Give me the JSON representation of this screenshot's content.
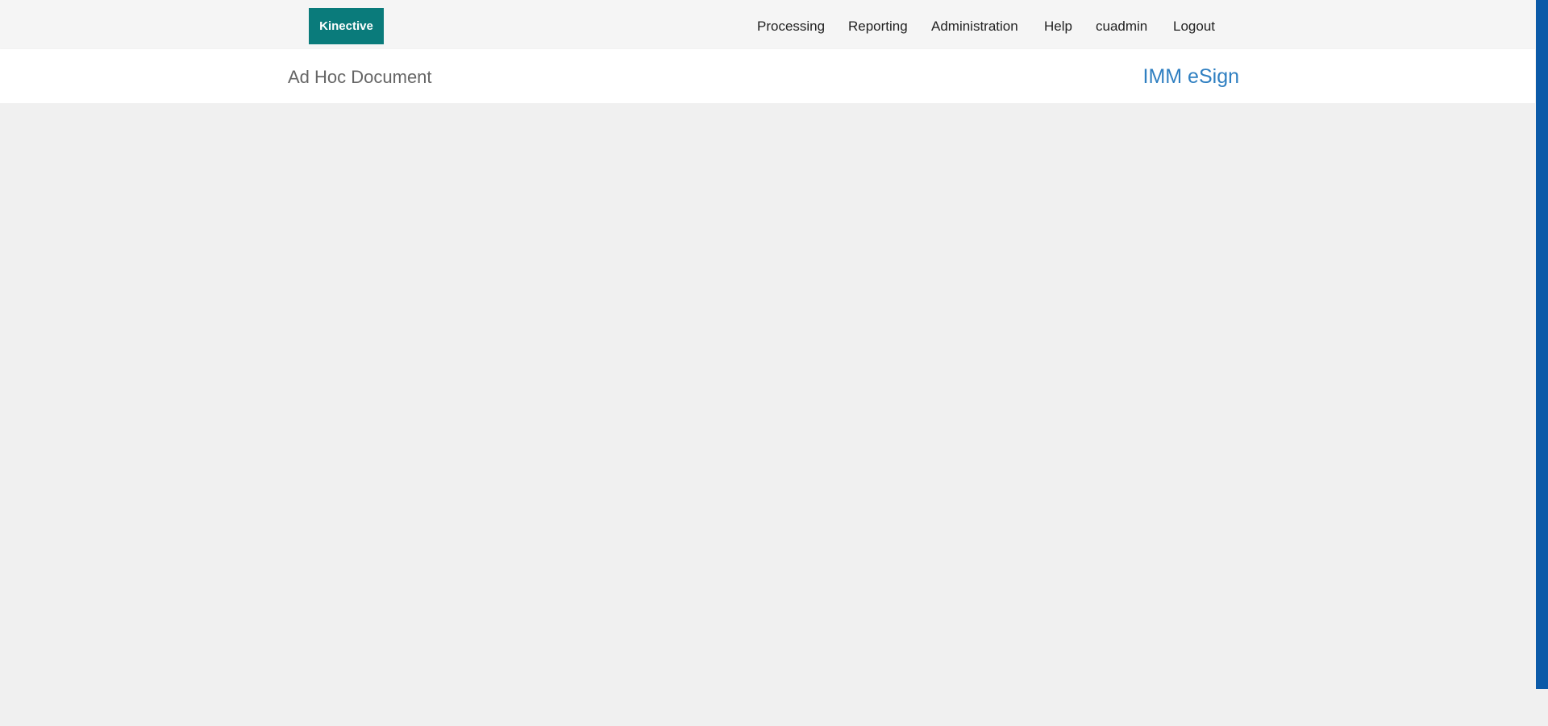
{
  "brand": {
    "logo_text": "Kinective",
    "logo_color": "#0a7b7b"
  },
  "nav": {
    "items": [
      {
        "label": "Processing"
      },
      {
        "label": "Reporting"
      },
      {
        "label": "Administration"
      },
      {
        "label": "Help"
      },
      {
        "label": "cuadmin"
      },
      {
        "label": "Logout"
      }
    ]
  },
  "header": {
    "page_title": "Ad Hoc Document",
    "product_name": "IMM eSign",
    "product_color": "#2f7fc1"
  },
  "colors": {
    "topbar_bg": "#f5f5f5",
    "content_bg": "#f0f0f0",
    "scrollbar_thumb": "#0b5aa8"
  }
}
